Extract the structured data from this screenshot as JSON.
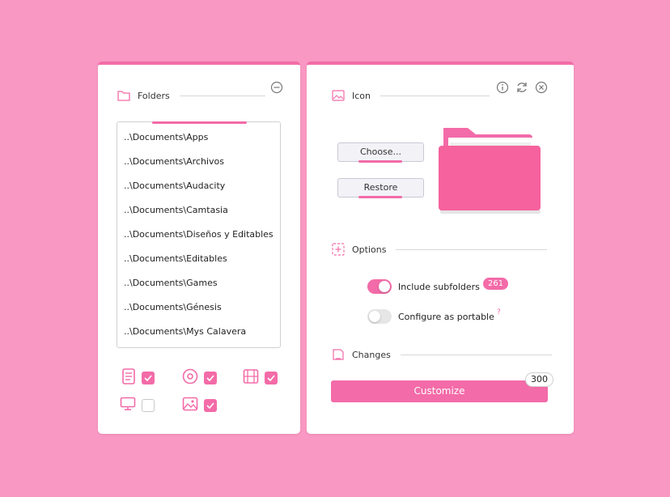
{
  "folders_panel": {
    "title": "Folders",
    "items": [
      "..\\Documents\\Apps",
      "..\\Documents\\Archivos",
      "..\\Documents\\Audacity",
      "..\\Documents\\Camtasia",
      "..\\Documents\\Diseños y Editables",
      "..\\Documents\\Editables",
      "..\\Documents\\Games",
      "..\\Documents\\Génesis",
      "..\\Documents\\Mys Calavera"
    ],
    "filters": [
      {
        "icon": "document-icon",
        "checked": true
      },
      {
        "icon": "disc-icon",
        "checked": true
      },
      {
        "icon": "film-icon",
        "checked": true
      },
      {
        "icon": "monitor-icon",
        "checked": false
      },
      {
        "icon": "image-icon",
        "checked": true
      }
    ]
  },
  "icon_panel": {
    "title": "Icon",
    "choose_label": "Choose...",
    "restore_label": "Restore",
    "options_title": "Options",
    "include_subfolders_label": "Include subfolders",
    "include_subfolders_on": true,
    "subfolder_count": "261",
    "portable_label": "Configure as portable",
    "portable_on": false,
    "help_mark": "?",
    "changes_title": "Changes",
    "customize_label": "Customize",
    "changes_count": "300"
  },
  "colors": {
    "background": "#f998c3",
    "accent": "#f36ba8",
    "folder": "#f5629d"
  }
}
